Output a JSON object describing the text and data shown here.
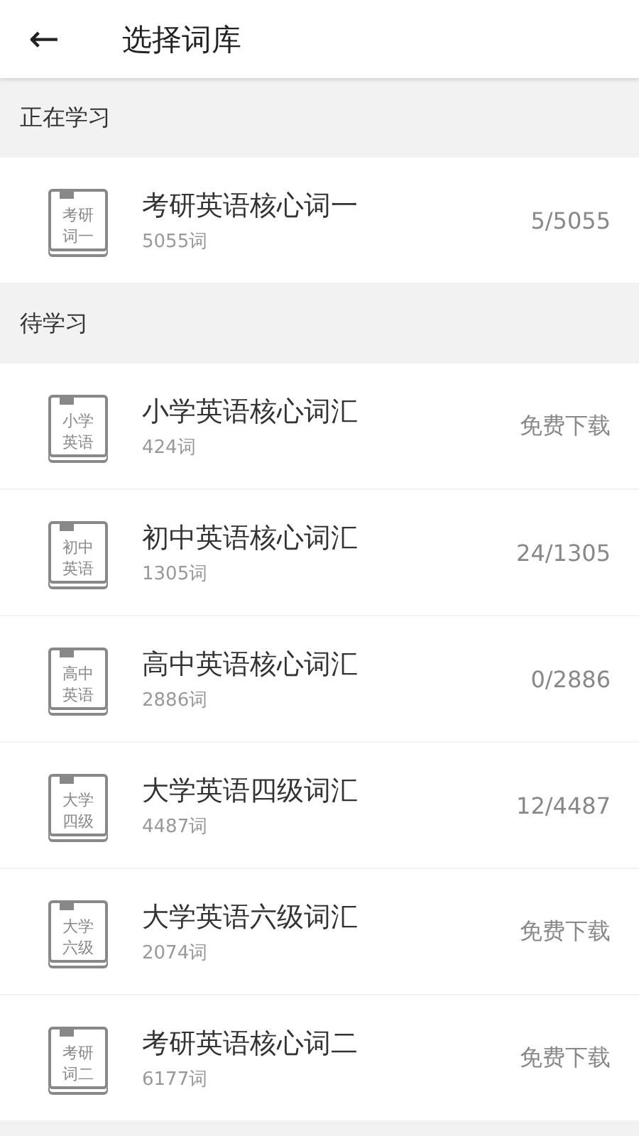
{
  "header": {
    "back": "←",
    "title": "选择词库"
  },
  "sections": [
    {
      "title": "正在学习",
      "items": [
        {
          "cover": [
            "考研",
            "词一"
          ],
          "name": "考研英语核心词一",
          "count": "5055词",
          "status": "5/5055"
        }
      ]
    },
    {
      "title": "待学习",
      "items": [
        {
          "cover": [
            "小学",
            "英语"
          ],
          "name": "小学英语核心词汇",
          "count": "424词",
          "status": "免费下载"
        },
        {
          "cover": [
            "初中",
            "英语"
          ],
          "name": "初中英语核心词汇",
          "count": "1305词",
          "status": "24/1305"
        },
        {
          "cover": [
            "高中",
            "英语"
          ],
          "name": "高中英语核心词汇",
          "count": "2886词",
          "status": "0/2886"
        },
        {
          "cover": [
            "大学",
            "四级"
          ],
          "name": "大学英语四级词汇",
          "count": "4487词",
          "status": "12/4487"
        },
        {
          "cover": [
            "大学",
            "六级"
          ],
          "name": "大学英语六级词汇",
          "count": "2074词",
          "status": "免费下载"
        },
        {
          "cover": [
            "考研",
            "词二"
          ],
          "name": "考研英语核心词二",
          "count": "6177词",
          "status": "免费下载"
        }
      ]
    }
  ]
}
